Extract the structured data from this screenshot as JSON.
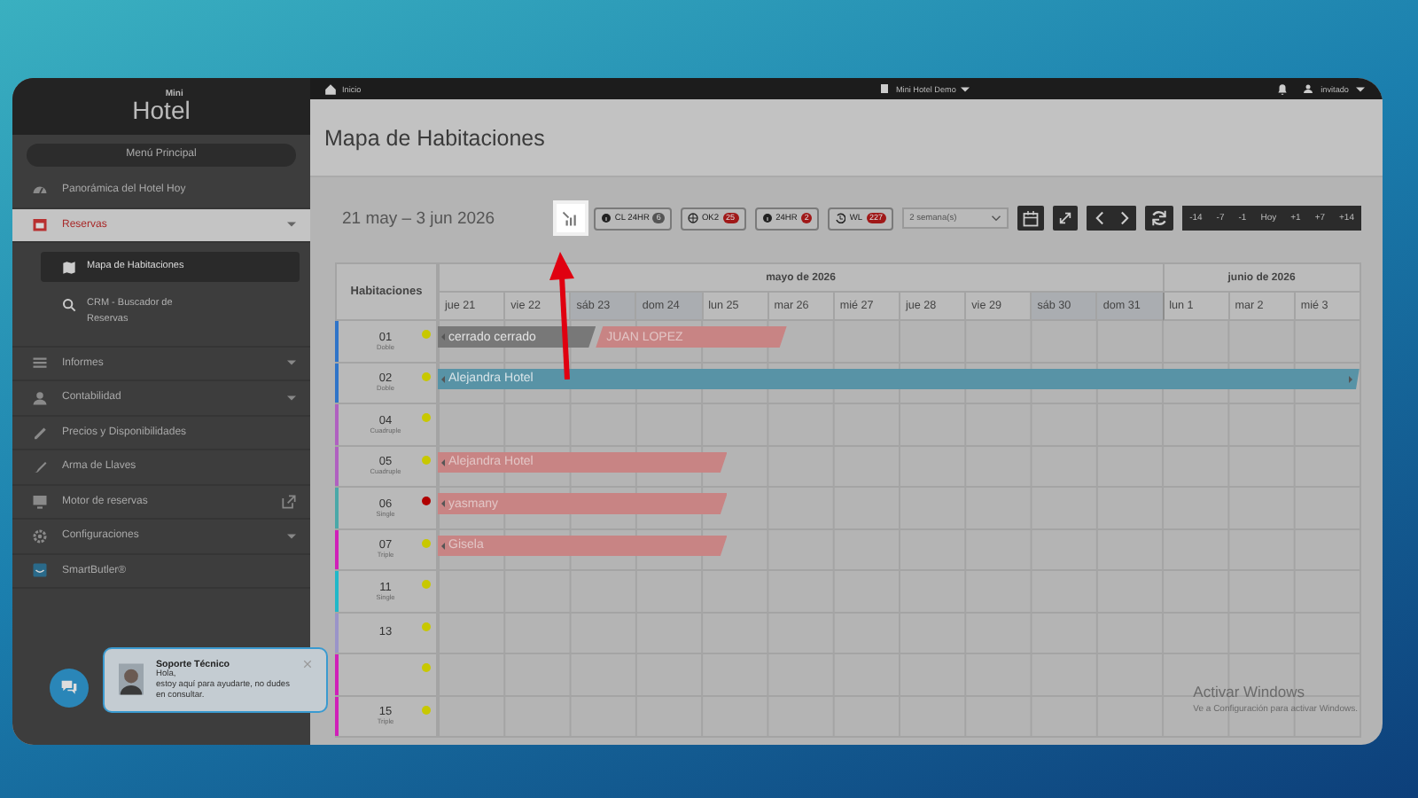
{
  "logo": {
    "small": "Mini",
    "big": "Hotel"
  },
  "top_bar": {
    "breadcrumb": "Inicio",
    "hotel_menu": "Mini Hotel Demo",
    "user_menu": "invitado"
  },
  "sidebar": {
    "menu_button": "Menú Principal",
    "items": [
      {
        "label": "Panorámica del Hotel Hoy",
        "selected": false,
        "expandable": false,
        "external": false
      },
      {
        "label": "Reservas",
        "selected": true,
        "expandable": true,
        "external": false,
        "children": [
          {
            "label": "Mapa de Habitaciones",
            "selected": true
          },
          {
            "label": "CRM - Buscador de Reservas",
            "selected": false
          }
        ]
      },
      {
        "label": "Informes",
        "selected": false,
        "expandable": true,
        "external": false
      },
      {
        "label": "Contabilidad",
        "selected": false,
        "expandable": true,
        "external": false
      },
      {
        "label": "Precios y Disponibilidades",
        "selected": false,
        "expandable": false,
        "external": false
      },
      {
        "label": "Arma de Llaves",
        "selected": false,
        "expandable": false,
        "external": false
      },
      {
        "label": "Motor de reservas",
        "selected": false,
        "expandable": false,
        "external": true
      },
      {
        "label": "Configuraciones",
        "selected": false,
        "expandable": true,
        "external": false
      },
      {
        "label": "SmartButler®",
        "selected": false,
        "expandable": false,
        "external": false
      }
    ]
  },
  "page_title": "Mapa de Habitaciones",
  "date_range": "21 may – 3 jun 2026",
  "toolbar": {
    "chart_button": {
      "highlighted": true
    },
    "filters": [
      {
        "label": "CL 24HR",
        "count": "6",
        "alert": false
      },
      {
        "label": "OK2",
        "count": "25",
        "alert": true
      },
      {
        "label": "24HR",
        "count": "2",
        "alert": true
      },
      {
        "label": "WL",
        "count": "227",
        "alert": true
      }
    ],
    "range_select": {
      "value": "2 semana(s)"
    },
    "shift_buttons": [
      "-14",
      "-7",
      "-1",
      "Hoy",
      "+1",
      "+7",
      "+14"
    ]
  },
  "calendar": {
    "rooms_header": "Habitaciones",
    "months": [
      {
        "label": "mayo de 2026",
        "days": [
          {
            "label": "jue 21",
            "weekend": false
          },
          {
            "label": "vie 22",
            "weekend": false
          },
          {
            "label": "sáb 23",
            "weekend": true
          },
          {
            "label": "dom 24",
            "weekend": true
          },
          {
            "label": "lun 25",
            "weekend": false
          },
          {
            "label": "mar 26",
            "weekend": false
          },
          {
            "label": "mié 27",
            "weekend": false
          },
          {
            "label": "jue 28",
            "weekend": false
          },
          {
            "label": "vie 29",
            "weekend": false
          },
          {
            "label": "sáb 30",
            "weekend": true
          },
          {
            "label": "dom 31",
            "weekend": true
          }
        ]
      },
      {
        "label": "junio de 2026",
        "days": [
          {
            "label": "lun 1",
            "weekend": false
          },
          {
            "label": "mar 2",
            "weekend": false
          },
          {
            "label": "mié 3",
            "weekend": false
          }
        ]
      }
    ],
    "rooms": [
      {
        "number": "01",
        "type": "Doble",
        "color": "#2f74c8",
        "dirty": false,
        "bookings": [
          {
            "guest": "cerrado cerrado",
            "kind": "closed"
          },
          {
            "guest": "JUAN LOPEZ",
            "kind": "reserved"
          }
        ]
      },
      {
        "number": "02",
        "type": "Doble",
        "color": "#2f74c8",
        "dirty": false,
        "bookings": [
          {
            "guest": "Alejandra Hotel",
            "kind": "checked_in",
            "continues": true
          }
        ]
      },
      {
        "number": "04",
        "type": "Cuadruple",
        "color": "#b060c0",
        "dirty": false
      },
      {
        "number": "05",
        "type": "Cuadruple",
        "color": "#b060c0",
        "dirty": false,
        "bookings": [
          {
            "guest": "Alejandra Hotel",
            "kind": "reserved"
          }
        ]
      },
      {
        "number": "06",
        "type": "Single",
        "color": "#4aa8a8",
        "dirty": true,
        "bookings": [
          {
            "guest": "yasmany",
            "kind": "reserved"
          }
        ]
      },
      {
        "number": "07",
        "type": "Triple",
        "color": "#d020b8",
        "dirty": false,
        "bookings": [
          {
            "guest": "Gisela",
            "kind": "reserved"
          }
        ]
      },
      {
        "number": "11",
        "type": "Single",
        "color": "#20b8c8",
        "dirty": false
      },
      {
        "number": "13",
        "color": "#9a94c8",
        "dirty": false
      },
      {
        "color": "#d020b8",
        "dirty": false
      },
      {
        "number": "15",
        "type": "Triple",
        "color": "#d020b8",
        "dirty": false
      }
    ]
  },
  "support_chat": {
    "title": "Soporte Técnico",
    "message": "Hola,\nestoy aquí para ayudarte, no dudes en consultar."
  },
  "os_notice": {
    "title": "Activar Windows",
    "text": "Ve a Configuración para activar Windows."
  }
}
